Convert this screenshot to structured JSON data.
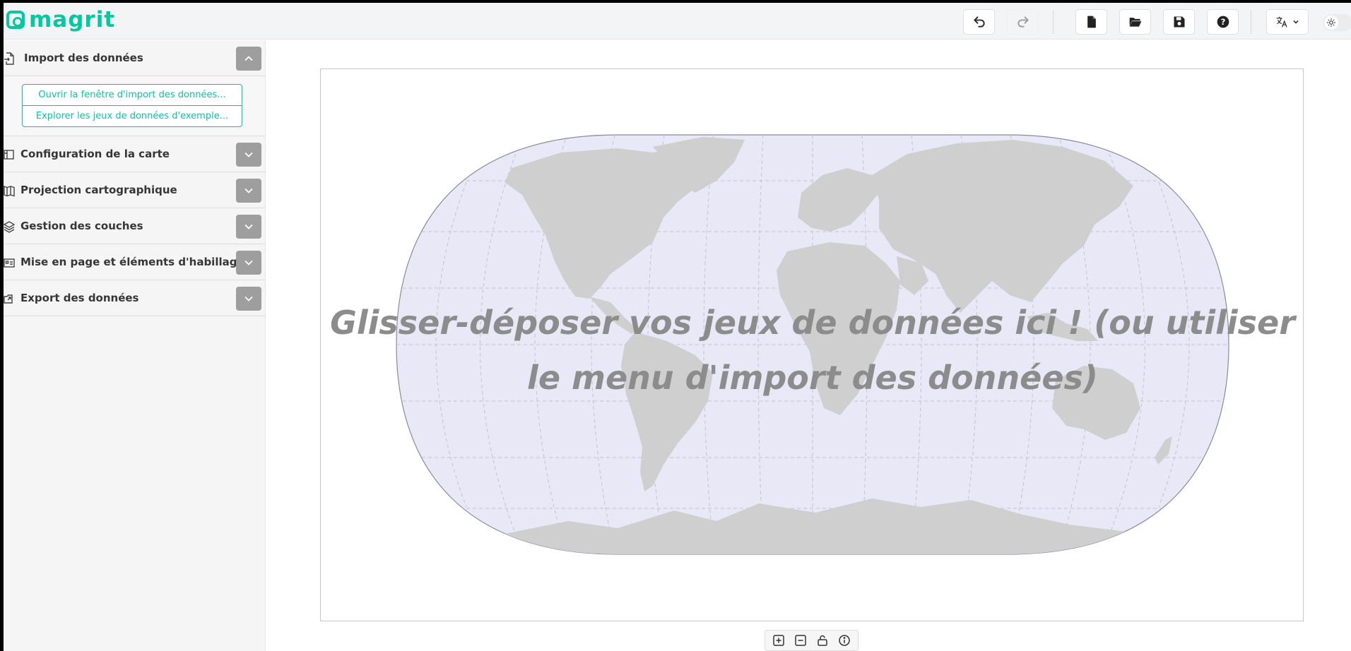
{
  "app": {
    "name": "magrit"
  },
  "header": {
    "buttons": [
      {
        "name": "undo-button",
        "icon": "undo-icon"
      },
      {
        "name": "redo-button",
        "icon": "redo-icon",
        "disabled": true
      },
      {
        "name": "new-project-button",
        "icon": "file-icon"
      },
      {
        "name": "open-project-button",
        "icon": "folder-open-icon"
      },
      {
        "name": "save-project-button",
        "icon": "floppy-icon"
      },
      {
        "name": "help-button",
        "icon": "question-icon"
      }
    ],
    "language_icon": "translate-icon",
    "theme_toggle_icon": "sun-icon"
  },
  "sidebar": {
    "sections": [
      {
        "key": "import",
        "title": "Import des données",
        "expanded": true,
        "icon": "file-import-icon"
      },
      {
        "key": "map",
        "title": "Configuration de la carte",
        "expanded": false,
        "icon": "map-config-icon"
      },
      {
        "key": "projection",
        "title": "Projection cartographique",
        "expanded": false,
        "icon": "map-projection-icon"
      },
      {
        "key": "layers",
        "title": "Gestion des couches",
        "expanded": false,
        "icon": "layers-icon"
      },
      {
        "key": "layout",
        "title": "Mise en page et éléments d'habillage",
        "expanded": false,
        "icon": "layout-icon"
      },
      {
        "key": "export",
        "title": "Export des données",
        "expanded": false,
        "icon": "export-icon"
      }
    ],
    "import": {
      "open_import_label": "Ouvrir la fenêtre d'import des données...",
      "explore_examples_label": "Explorer les jeux de données d'exemple..."
    }
  },
  "map": {
    "drop_message_line1": "Glisser-déposer vos jeux de données ici ! (ou utiliser",
    "drop_message_line2": "le menu d'import des données)",
    "ocean_color": "#e8e8f6",
    "land_color": "#cfcfcf"
  },
  "map_tools": [
    {
      "name": "zoom-in-button",
      "icon": "zoom-in-icon"
    },
    {
      "name": "zoom-out-button",
      "icon": "zoom-out-icon"
    },
    {
      "name": "lock-button",
      "icon": "unlock-icon"
    },
    {
      "name": "info-button",
      "icon": "info-icon"
    }
  ],
  "colors": {
    "accent": "#00c9a0",
    "toggle_button": "#9e9e9e"
  }
}
